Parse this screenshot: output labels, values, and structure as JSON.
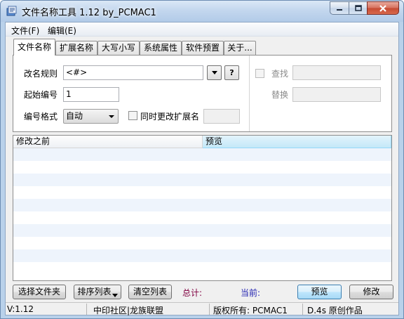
{
  "window": {
    "title": "文件名称工具 1.12  by_PCMAC1",
    "icon": "app-tool-icon"
  },
  "menu": [
    "文件(F)",
    "编辑(E)"
  ],
  "tabs": [
    "文件名称",
    "扩展名称",
    "大写小写",
    "系统属性",
    "软件预置",
    "关于..."
  ],
  "panel": {
    "rename_rule_label": "改名规则",
    "rename_rule_value": "<#>",
    "help_button": "?",
    "start_number_label": "起始编号",
    "start_number_value": "1",
    "number_format_label": "编号格式",
    "number_format_value": "自动",
    "change_ext_label": "同时更改扩展名",
    "find_label": "查找",
    "replace_label": "替换"
  },
  "list": {
    "columns": [
      "修改之前",
      "预览"
    ]
  },
  "buttons": {
    "select_files": "选择文件夹",
    "sort_list": "排序列表",
    "clear_list": "清空列表",
    "total_label": "总计:",
    "current_label": "当前:",
    "preview": "预览",
    "modify": "修改"
  },
  "status": {
    "version": "V:1.12",
    "community": "中印社区|龙族联盟",
    "copyright": "版权所有: PCMAC1",
    "credit": "D.4s 原创作品"
  }
}
